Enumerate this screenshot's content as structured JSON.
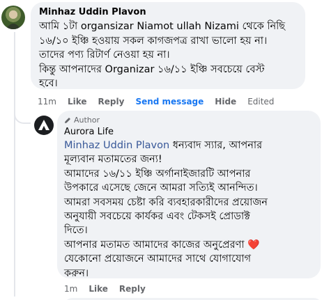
{
  "comment": {
    "author": "Minhaz Uddin Plavon",
    "lines": [
      "আমি ১টা organsizar Niamot ullah Nizami থেকে নিছি",
      "১৬/১০ ইঞ্চি হওয়ায় সকল কাগজপত্র রাখা ভালো হয় না।",
      "তাদের পণ্য রিটার্ণ নেওয়া হয় না।",
      "কিন্তু আপনাদের Organizar ১৬/১১ ইঞ্চি সবচেয়ে বেস্ট",
      "হবে।"
    ],
    "actions": {
      "time": "11m",
      "like": "Like",
      "reply": "Reply",
      "send_message": "Send message",
      "hide": "Hide",
      "edited": "Edited"
    }
  },
  "reply": {
    "badge": "Author",
    "author": "Aurora Life",
    "mention": "Minhaz Uddin Plavon",
    "first_line_rest": " ধন্যবাদ স্যার, আপনার",
    "lines": [
      "মূল্যবান মতামতের জন্য!",
      "আমাদের ১৬/১১ ইঞ্চি অর্গানাইজারটি আপনার",
      "উপকারে এসেছে জেনে আমরা সত্যিই আনন্দিত।",
      "আমরা সবসময় চেষ্টা করি ব্যবহারকারীদের প্রয়োজন",
      "অনুযায়ী সবচেয়ে কার্যকর এবং টেকসই প্রোডাক্ট",
      "দিতে।",
      "আপনার মতামত আমাদের কাজের অনুপ্রেরণা",
      "যেকোনো প্রয়োজনে আমাদের সাথে যোগাযোগ",
      "করুন।"
    ],
    "heart": "❤️",
    "actions": {
      "time": "1m",
      "like": "Like",
      "reply": "Reply"
    }
  },
  "colors": {
    "bubble": "#f0f2f5",
    "link": "#1877f2",
    "mention": "#385898",
    "muted": "#65676b"
  }
}
